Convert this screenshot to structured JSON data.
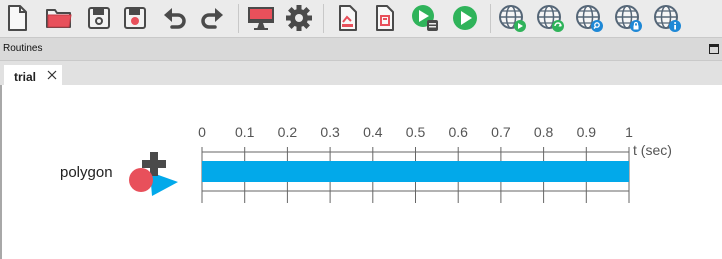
{
  "toolbar": {
    "buttons": [
      {
        "name": "new-file-icon",
        "icon": "new-file"
      },
      {
        "name": "open-folder-icon",
        "icon": "open-folder"
      },
      {
        "name": "save-icon",
        "icon": "save"
      },
      {
        "name": "save-as-icon",
        "icon": "save-as"
      },
      {
        "name": "undo-icon",
        "icon": "undo"
      },
      {
        "name": "redo-icon",
        "icon": "redo"
      },
      {
        "name": "monitor-icon",
        "icon": "monitor"
      },
      {
        "name": "gear-icon",
        "icon": "gear"
      },
      {
        "name": "compile-script-icon",
        "icon": "compile-script"
      },
      {
        "name": "compile-runner-icon",
        "icon": "compile-runner"
      },
      {
        "name": "pilot-run-icon",
        "icon": "pilot-run"
      },
      {
        "name": "run-icon",
        "icon": "run"
      },
      {
        "name": "globe-run-icon",
        "icon": "globe-run"
      },
      {
        "name": "globe-sync-icon",
        "icon": "globe-sync"
      },
      {
        "name": "globe-search-icon",
        "icon": "globe-search"
      },
      {
        "name": "globe-lock-icon",
        "icon": "globe-lock"
      },
      {
        "name": "globe-info-icon",
        "icon": "globe-info"
      }
    ]
  },
  "routines_panel": {
    "title": "Routines"
  },
  "tabs": [
    {
      "label": "trial"
    }
  ],
  "timeline": {
    "ticks": [
      "0",
      "0.1",
      "0.2",
      "0.3",
      "0.4",
      "0.5",
      "0.6",
      "0.7",
      "0.8",
      "0.9",
      "1"
    ],
    "axis_label": "t (sec)",
    "components": [
      {
        "name": "polygon",
        "start": 0,
        "stop": 1,
        "bar_color": "#02a9ea"
      }
    ]
  },
  "colors": {
    "accent_green": "#2fb35a",
    "accent_red": "#e8505b",
    "globe": "#556677",
    "bar": "#02a9ea"
  }
}
